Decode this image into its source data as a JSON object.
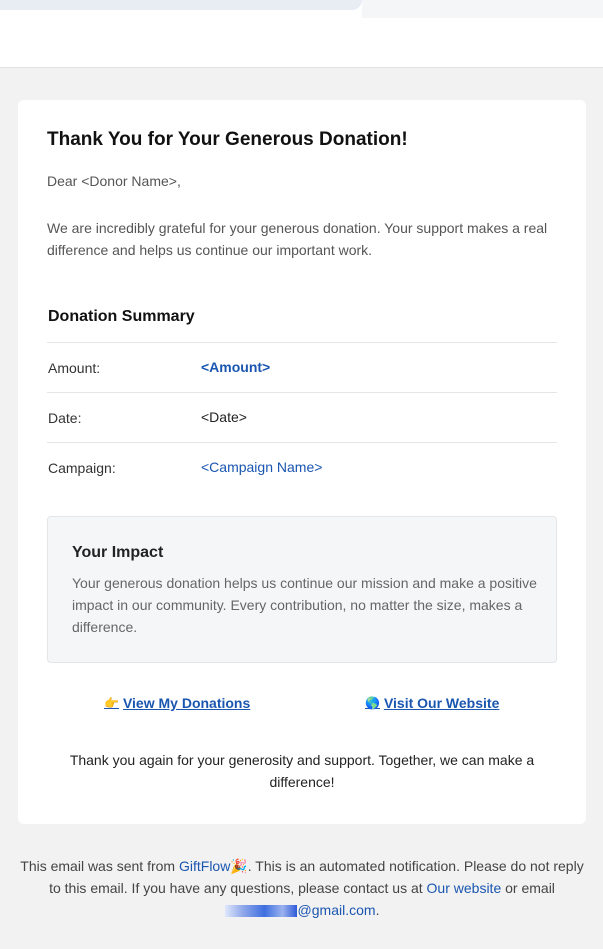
{
  "colors": {
    "accent_link": "#1a56b0",
    "page_background": "#f2f2f2",
    "card_background": "#ffffff",
    "impact_background": "#f5f6f8"
  },
  "email": {
    "title": "Thank You for Your Generous Donation!",
    "greeting": "Dear <Donor Name>,",
    "intro": "We are incredibly grateful for your generous donation. Your support makes a real difference and helps us continue our important work.",
    "summary": {
      "title": "Donation Summary",
      "rows": [
        {
          "label": "Amount:",
          "value": "<Amount>"
        },
        {
          "label": "Date:",
          "value": "<Date>"
        },
        {
          "label": "Campaign:",
          "value": "<Campaign Name>"
        }
      ]
    },
    "impact": {
      "title": "Your Impact",
      "text": "Your generous donation helps us continue our mission and make a positive impact in our community. Every contribution, no matter the size, makes a difference."
    },
    "actions": {
      "view_donations": {
        "icon": "pointing-hand-icon",
        "emoji": "👉",
        "label": "View My Donations"
      },
      "visit_website": {
        "icon": "globe-icon",
        "emoji": "🌎",
        "label": "Visit Our Website"
      }
    },
    "closing": "Thank you again for your generosity and support. Together, we can make a difference!"
  },
  "footer": {
    "part1": "This email was sent from ",
    "brand_link": "GiftFlow",
    "brand_emoji": "🎉",
    "part2": ". This is an automated notification. Please do not reply to this email. If you have any questions, please contact us at ",
    "website_link": "Our website",
    "part3": " or email ",
    "email_domain": "@gmail.com",
    "end": "."
  }
}
